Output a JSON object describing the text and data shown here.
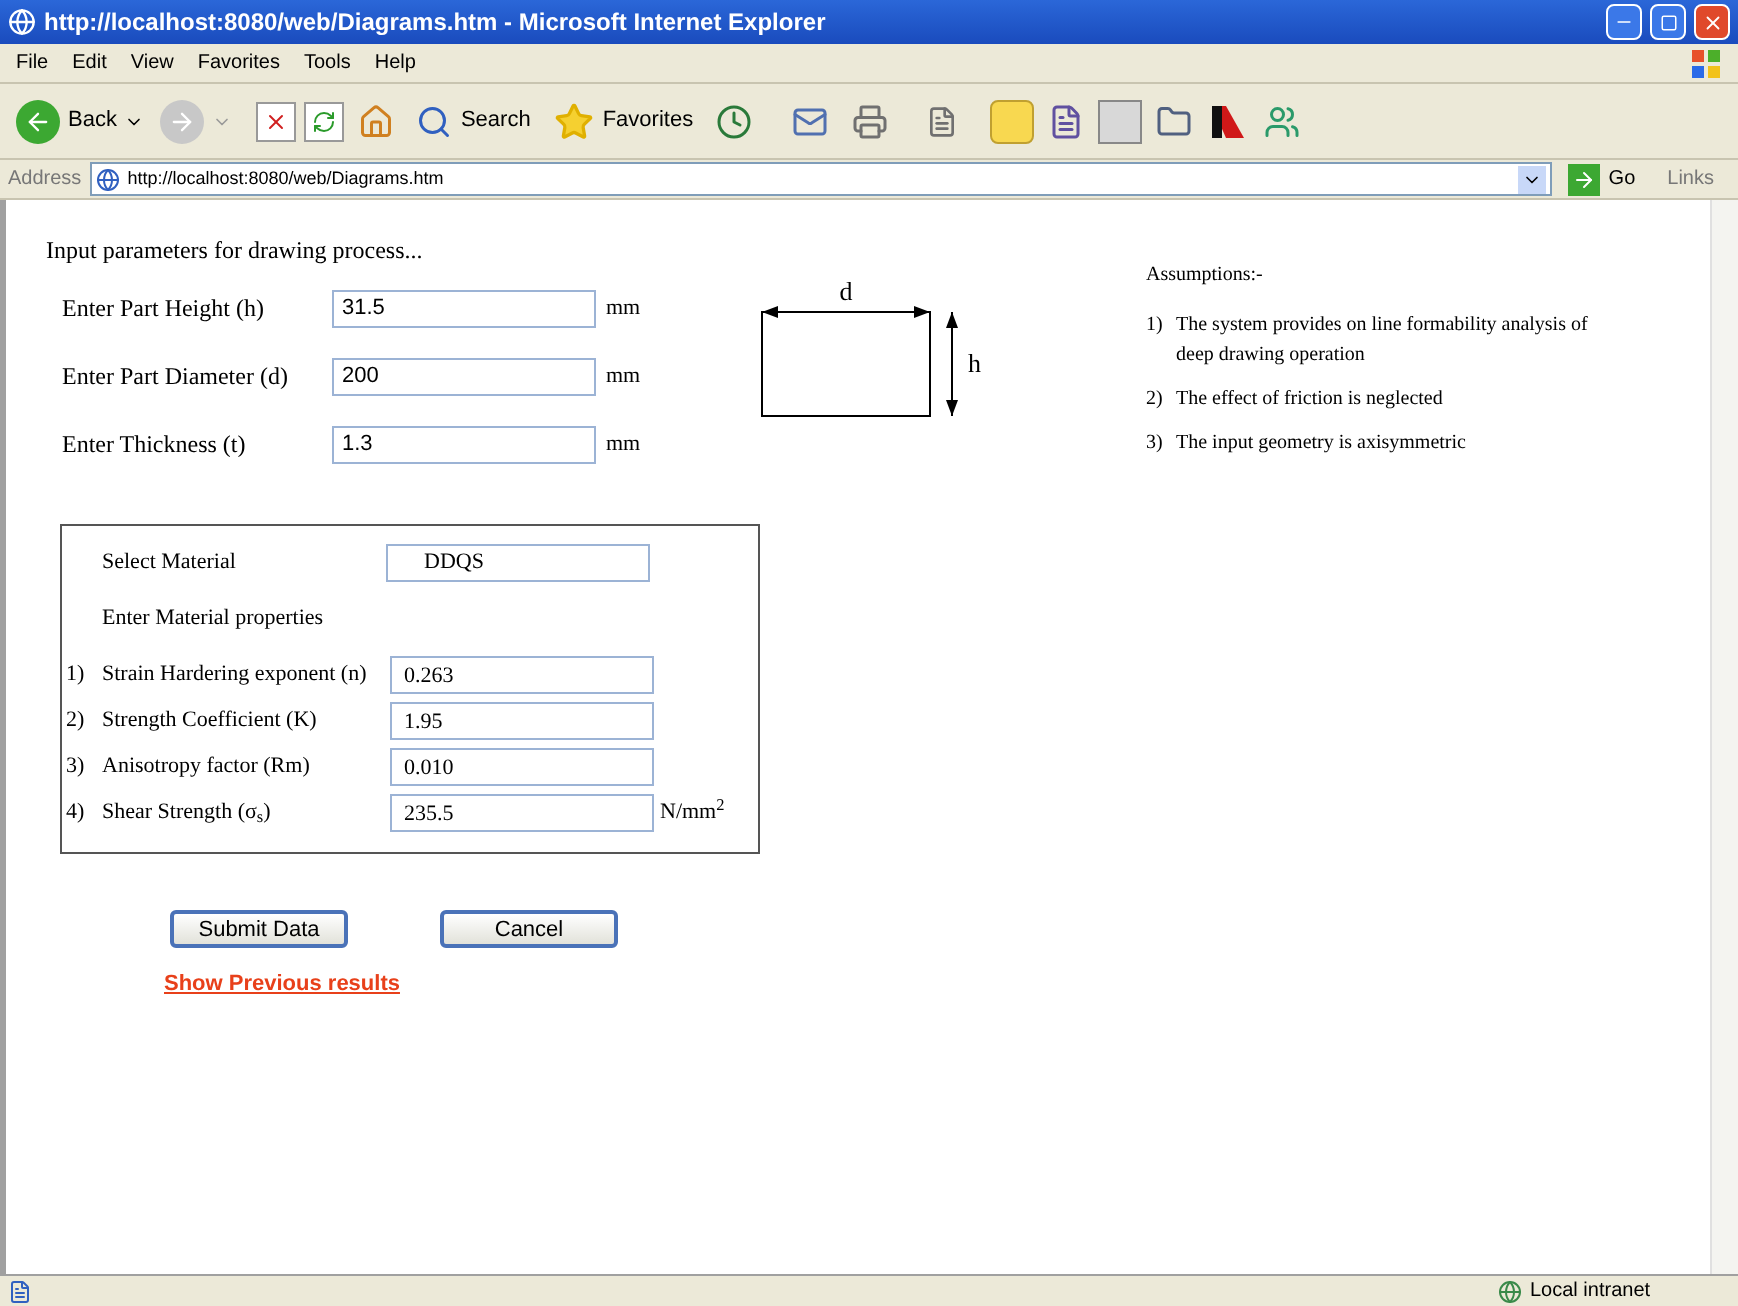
{
  "window": {
    "title": "http://localhost:8080/web/Diagrams.htm - Microsoft Internet Explorer"
  },
  "menu": [
    "File",
    "Edit",
    "View",
    "Favorites",
    "Tools",
    "Help"
  ],
  "toolbar": {
    "back": "Back",
    "search": "Search",
    "favorites": "Favorites"
  },
  "address_bar": {
    "label": "Address",
    "url": "http://localhost:8080/web/Diagrams.htm",
    "go": "Go",
    "links": "Links"
  },
  "form": {
    "heading": "Input parameters for drawing process...",
    "fields": [
      {
        "label": "Enter Part Height (h)",
        "value": "31.5",
        "unit": "mm"
      },
      {
        "label": "Enter Part Diameter (d)",
        "value": "200",
        "unit": "mm"
      },
      {
        "label": "Enter Thickness (t)",
        "value": "1.3",
        "unit": "mm"
      }
    ],
    "diagram": {
      "width_label": "d",
      "height_label": "h"
    },
    "material": {
      "select_label": "Select Material",
      "value": "DDQS",
      "properties_heading": "Enter Material properties",
      "properties": [
        {
          "number": "1)",
          "label": "Strain Hardering exponent (n)",
          "value": "0.263"
        },
        {
          "number": "2)",
          "label": "Strength Coefficient (K)",
          "value": "1.95"
        },
        {
          "number": "3)",
          "label": "Anisotropy factor (Rm)",
          "value": "0.010"
        },
        {
          "number": "4)",
          "label": "Shear Strength (σ$_{s}$)",
          "value": "235.5",
          "unit": "N/mm$^{2}$"
        }
      ]
    },
    "buttons": [
      "Submit Data",
      "Cancel"
    ],
    "link": "Show Previous results"
  },
  "assumptions": {
    "title": "Assumptions:-",
    "items": [
      {
        "number": "1)",
        "text": "The system provides on line formability analysis of deep drawing operation"
      },
      {
        "number": "2)",
        "text": "The effect of friction is neglected"
      },
      {
        "number": "3)",
        "text": "The input geometry is axisymmetric"
      }
    ]
  },
  "status_bar": {
    "zone": "Local intranet"
  }
}
